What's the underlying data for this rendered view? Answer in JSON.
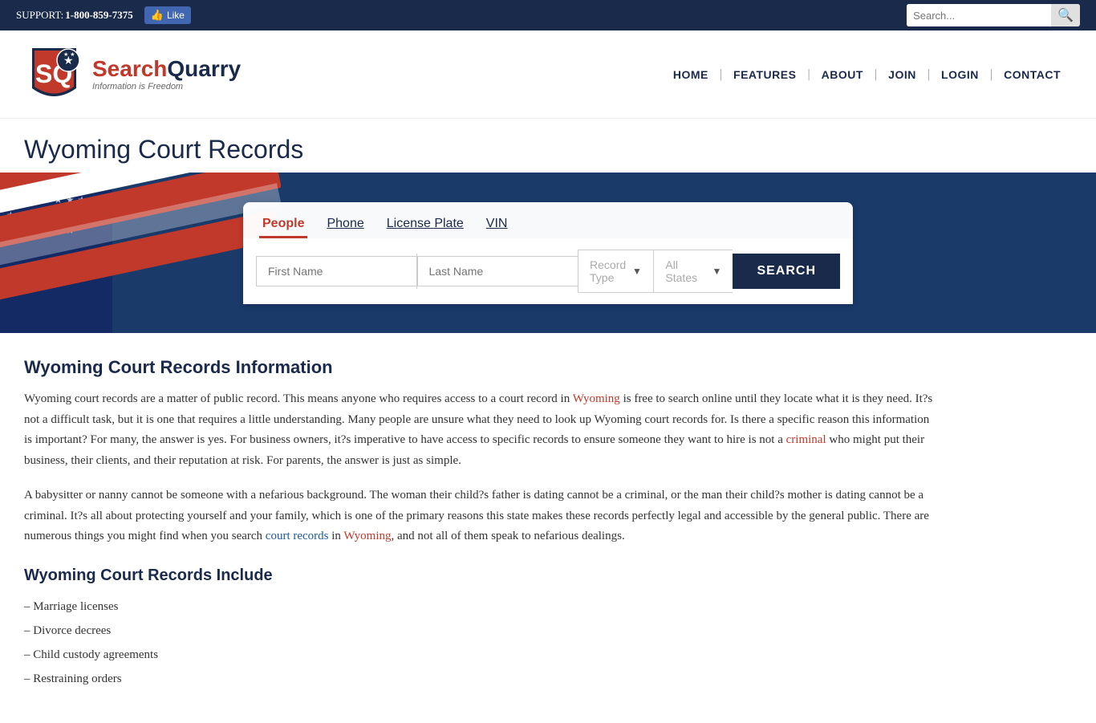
{
  "topbar": {
    "support_label": "SUPPORT:",
    "phone": "1-800-859-7375",
    "fb_label": "Like",
    "search_placeholder": "Search..."
  },
  "nav": {
    "logo_text_sq": "Search",
    "logo_text_quarry": "Quarry",
    "logo_tagline": "Information is Freedom",
    "items": [
      {
        "label": "HOME",
        "id": "home"
      },
      {
        "label": "FEATURES",
        "id": "features"
      },
      {
        "label": "ABOUT",
        "id": "about"
      },
      {
        "label": "JOIN",
        "id": "join"
      },
      {
        "label": "LOGIN",
        "id": "login"
      },
      {
        "label": "CONTACT",
        "id": "contact"
      }
    ]
  },
  "page": {
    "title": "Wyoming Court Records"
  },
  "search": {
    "tabs": [
      {
        "label": "People",
        "id": "people",
        "active": true
      },
      {
        "label": "Phone",
        "id": "phone",
        "active": false
      },
      {
        "label": "License Plate",
        "id": "license-plate",
        "active": false
      },
      {
        "label": "VIN",
        "id": "vin",
        "active": false
      }
    ],
    "firstname_placeholder": "First Name",
    "lastname_placeholder": "Last Name",
    "recordtype_label": "Record Type",
    "allstates_label": "All States",
    "search_btn": "SEARCH"
  },
  "content": {
    "info_title": "Wyoming Court Records Information",
    "para1": "Wyoming court records are a matter of public record. This means anyone who requires access to a court record in Wyoming is free to search online until they locate what it is they need. It?s not a difficult task, but it is one that requires a little understanding. Many people are unsure what they need to look up Wyoming court records for. Is there a specific reason this information is important? For many, the answer is yes. For business owners, it?s imperative to have access to specific records to ensure someone they want to hire is not a criminal who might put their business, their clients, and their reputation at risk. For parents, the answer is just as simple.",
    "para1_link1": "Wyoming",
    "para1_link2": "criminal",
    "para2": "A babysitter or nanny cannot be someone with a nefarious background. The woman their child?s father is dating cannot be a criminal, or the man their child?s mother is dating cannot be a criminal. It?s all about protecting yourself and your family, which is one of the primary reasons this state makes these records perfectly legal and accessible by the general public. There are numerous things you might find when you search court records in Wyoming, and not all of them speak to nefarious dealings.",
    "para2_link1": "court records",
    "para2_link2": "Wyoming",
    "include_title": "Wyoming Court Records Include",
    "list_items": [
      "– Marriage licenses",
      "– Divorce decrees",
      "– Child custody agreements",
      "– Restraining orders"
    ]
  }
}
